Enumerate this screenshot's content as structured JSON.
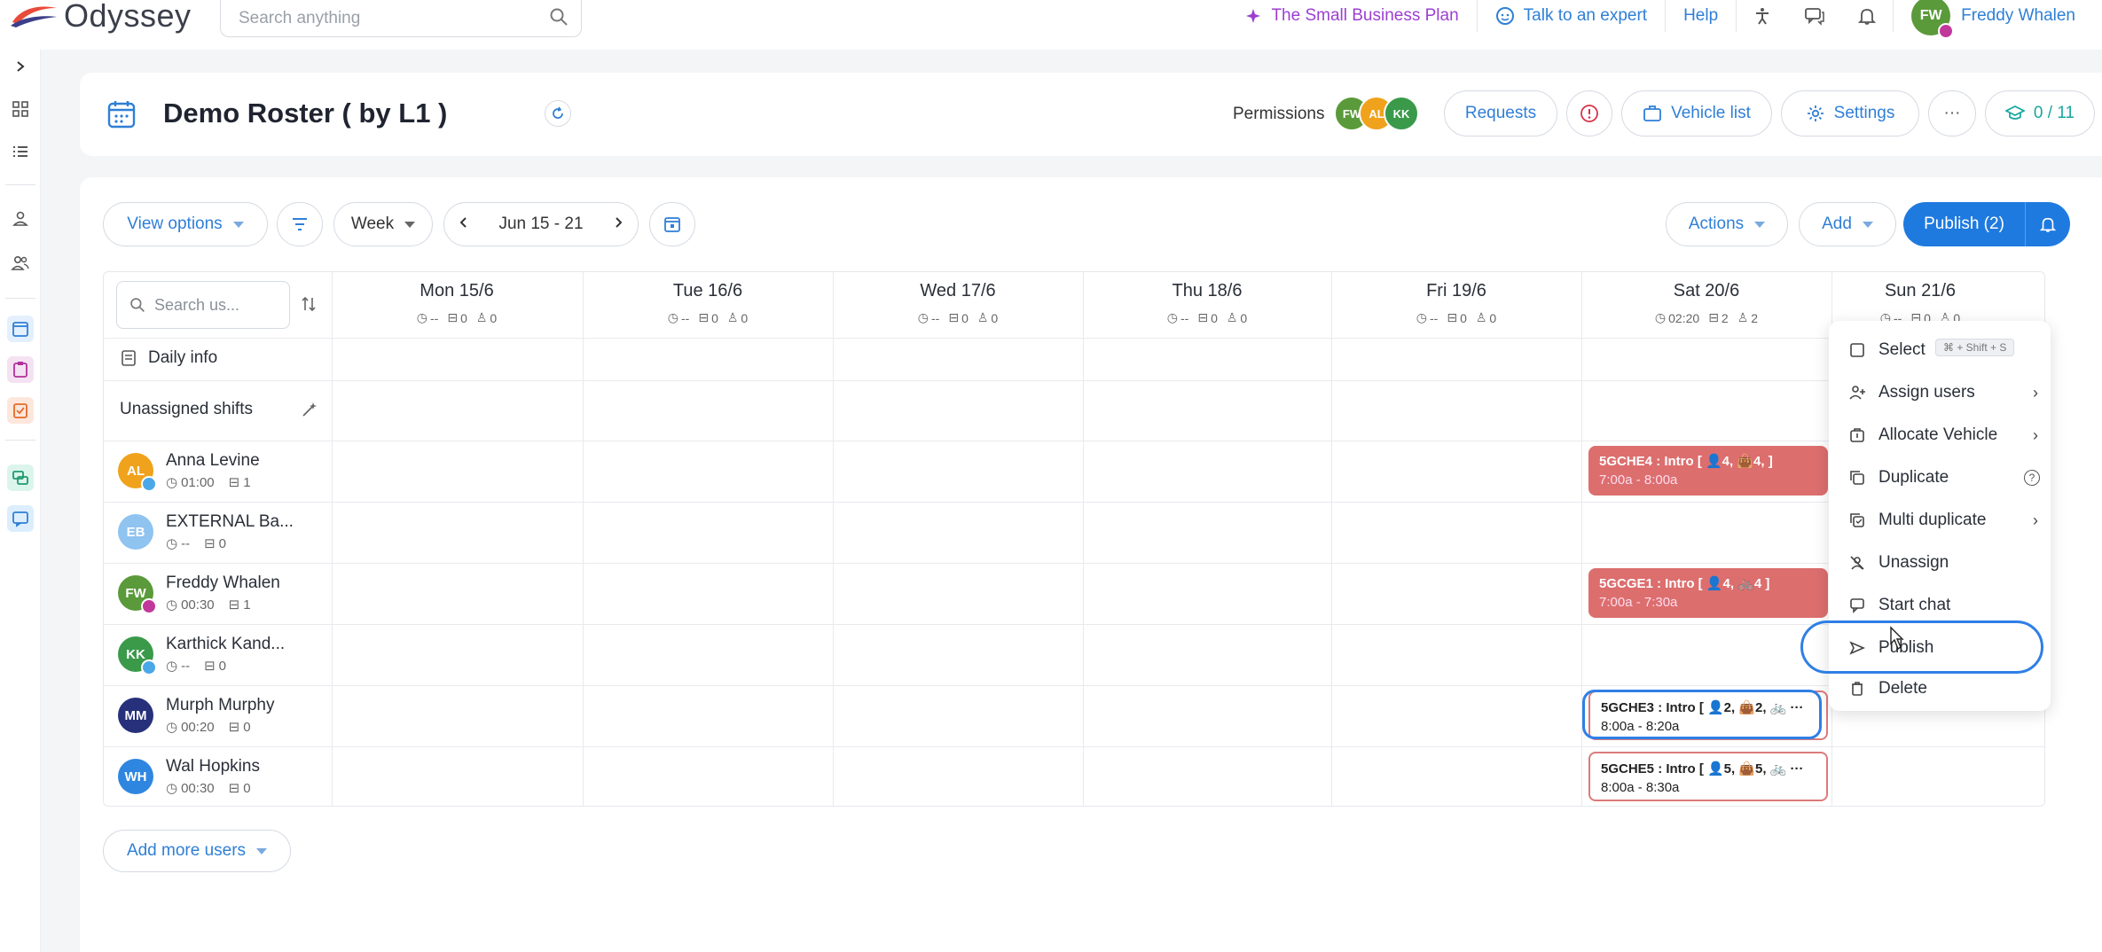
{
  "app": {
    "name": "Odyssey"
  },
  "topbar": {
    "search_placeholder": "Search anything",
    "plan_link": "The Small Business Plan",
    "expert_link": "Talk to an expert",
    "help_link": "Help",
    "user": {
      "initials": "FW",
      "name": "Freddy Whalen"
    }
  },
  "header": {
    "title": "Demo Roster ( by L1 )",
    "permissions_label": "Permissions",
    "permission_avatars": [
      {
        "initials": "FW",
        "color": "#5a9a3a"
      },
      {
        "initials": "AL",
        "color": "#f0a21c"
      },
      {
        "initials": "KK",
        "color": "#3a9a4a"
      }
    ],
    "requests_label": "Requests",
    "vehicle_list_label": "Vehicle list",
    "settings_label": "Settings",
    "more_label": "···",
    "progress_label": "0 / 11"
  },
  "toolbar": {
    "view_options": "View options",
    "week": "Week",
    "date_range": "Jun 15 - 21",
    "actions": "Actions",
    "add": "Add",
    "publish": "Publish (2)"
  },
  "grid": {
    "user_search_placeholder": "Search us...",
    "days": [
      {
        "name": "Mon 15/6",
        "time": "--",
        "shifts": "0",
        "users": "0"
      },
      {
        "name": "Tue 16/6",
        "time": "--",
        "shifts": "0",
        "users": "0"
      },
      {
        "name": "Wed 17/6",
        "time": "--",
        "shifts": "0",
        "users": "0"
      },
      {
        "name": "Thu 18/6",
        "time": "--",
        "shifts": "0",
        "users": "0"
      },
      {
        "name": "Fri 19/6",
        "time": "--",
        "shifts": "0",
        "users": "0"
      },
      {
        "name": "Sat 20/6",
        "time": "02:20",
        "shifts": "2",
        "users": "2"
      },
      {
        "name": "Sun 21/6",
        "time": "--",
        "shifts": "0",
        "users": "0"
      }
    ],
    "daily_info": "Daily info",
    "unassigned": "Unassigned shifts",
    "users": [
      {
        "initials": "AL",
        "name": "Anna Levine",
        "time": "01:00",
        "shifts": "1",
        "color": "#f0a21c",
        "badge": "#4aa8e8"
      },
      {
        "initials": "EB",
        "name": "EXTERNAL Ba...",
        "time": "--",
        "shifts": "0",
        "color": "#8fc3f0",
        "badge": ""
      },
      {
        "initials": "FW",
        "name": "Freddy Whalen",
        "time": "00:30",
        "shifts": "1",
        "color": "#5a9a3a",
        "badge": "#c2389a"
      },
      {
        "initials": "KK",
        "name": "Karthick Kand...",
        "time": "--",
        "shifts": "0",
        "color": "#3a9a4a",
        "badge": "#4aa8e8"
      },
      {
        "initials": "MM",
        "name": "Murph Murphy",
        "time": "00:20",
        "shifts": "0",
        "color": "#27307a",
        "badge": ""
      },
      {
        "initials": "WH",
        "name": "Wal Hopkins",
        "time": "00:30",
        "shifts": "0",
        "color": "#2f86e0",
        "badge": ""
      }
    ],
    "shifts": [
      {
        "title": "5GCHE4 : Intro [ 👤4, 👜4, ]",
        "hours": "7:00a - 8:00a"
      },
      {
        "title": "5GCGE1 : Intro [ 👤4, 🚲4 ]",
        "hours": "7:00a - 7:30a"
      },
      {
        "title": "5GCHE3 : Intro [ 👤2, 👜2, 🚲 ···",
        "hours": "8:00a - 8:20a"
      },
      {
        "title": "5GCHE5 : Intro [ 👤5, 👜5, 🚲 ···",
        "hours": "8:00a - 8:30a"
      }
    ],
    "add_more_users": "Add more users"
  },
  "context_menu": {
    "select": "Select",
    "select_shortcut": "⌘ + Shift + S",
    "assign_users": "Assign users",
    "allocate_vehicle": "Allocate Vehicle",
    "duplicate": "Duplicate",
    "multi_duplicate": "Multi duplicate",
    "unassign": "Unassign",
    "start_chat": "Start chat",
    "publish": "Publish",
    "delete": "Delete"
  },
  "colors": {
    "accent": "#1f7ae0",
    "shift": "#dc6e6e",
    "plan": "#9c3fd1"
  }
}
